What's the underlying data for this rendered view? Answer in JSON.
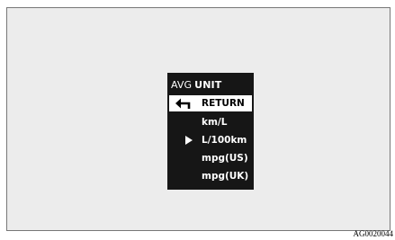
{
  "menu": {
    "title_part1": "AVG",
    "title_part2": "UNIT",
    "items": [
      {
        "label": "RETURN",
        "icon": "return-arrow-icon",
        "selected": true
      },
      {
        "label": "km/L"
      },
      {
        "label": "L/100km",
        "icon": "pointer-triangle-icon",
        "current": true
      },
      {
        "label": "mpg(US)"
      },
      {
        "label": "mpg(UK)"
      }
    ]
  },
  "figure_id": "AG0020044",
  "colors": {
    "background": "#ececec",
    "menu_background": "#161616",
    "highlight": "#ffffff",
    "text": "#ffffff"
  }
}
